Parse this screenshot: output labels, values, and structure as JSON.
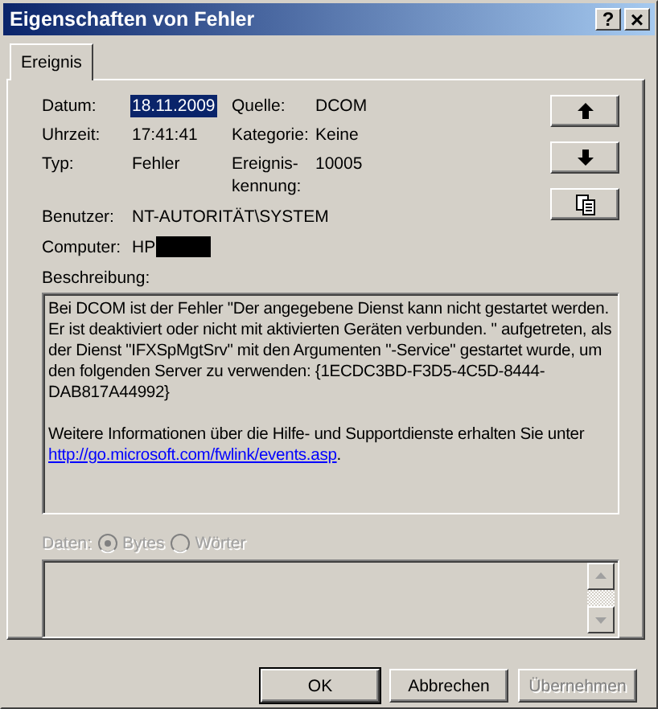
{
  "window": {
    "title": "Eigenschaften von Fehler",
    "title_buttons": [
      {
        "kind": "help",
        "label": "?"
      },
      {
        "kind": "close",
        "label": "×"
      }
    ]
  },
  "tabs": [
    {
      "label": "Ereignis",
      "selected": true
    }
  ],
  "fields": [
    {
      "label": "Datum:",
      "value": "18.11.2009",
      "selected": true
    },
    {
      "label": "Quelle:",
      "value": "DCOM",
      "selected": false
    },
    {
      "label": "Uhrzeit:",
      "value": "17:41:41",
      "selected": false
    },
    {
      "label": "Kategorie:",
      "value": "Keine",
      "selected": false
    },
    {
      "label": "Typ:",
      "value": "Fehler",
      "selected": false
    },
    {
      "label": "Ereignis-kennung:",
      "value": "10005",
      "selected": false
    }
  ],
  "wide_fields": [
    {
      "label": "Benutzer:",
      "value": "NT-AUTORITÄT\\SYSTEM",
      "redacted": false
    },
    {
      "label": "Computer:",
      "value": "HP",
      "redacted": true
    }
  ],
  "nav_buttons": [
    {
      "kind": "up"
    },
    {
      "kind": "down"
    },
    {
      "kind": "copy"
    }
  ],
  "description": {
    "label": "Beschreibung:",
    "paragraphs": [
      {
        "text": "Bei DCOM ist der Fehler \"Der angegebene Dienst kann nicht gestartet werden. Er ist deaktiviert oder nicht mit aktivierten Geräten verbunden. \" aufgetreten, als der Dienst \"IFXSpMgtSrv\" mit den Argumenten \"-Service\" gestartet wurde, um den folgenden Server zu verwenden: {1ECDC3BD-F3D5-4C5D-8444-DAB817A44992}"
      },
      {
        "text": "Weitere Informationen über die Hilfe- und Supportdienste erhalten Sie unter ",
        "link": "http://go.microsoft.com/fwlink/events.asp",
        "after": "."
      }
    ]
  },
  "data": {
    "label": "Daten:",
    "disabled": true,
    "options": [
      {
        "label": "Bytes",
        "selected": true
      },
      {
        "label": "Wörter",
        "selected": false
      }
    ]
  },
  "buttons": [
    {
      "label": "OK",
      "default": true,
      "disabled": false
    },
    {
      "label": "Abbrechen",
      "default": false,
      "disabled": false
    },
    {
      "label": "Übernehmen",
      "default": false,
      "disabled": true
    }
  ]
}
